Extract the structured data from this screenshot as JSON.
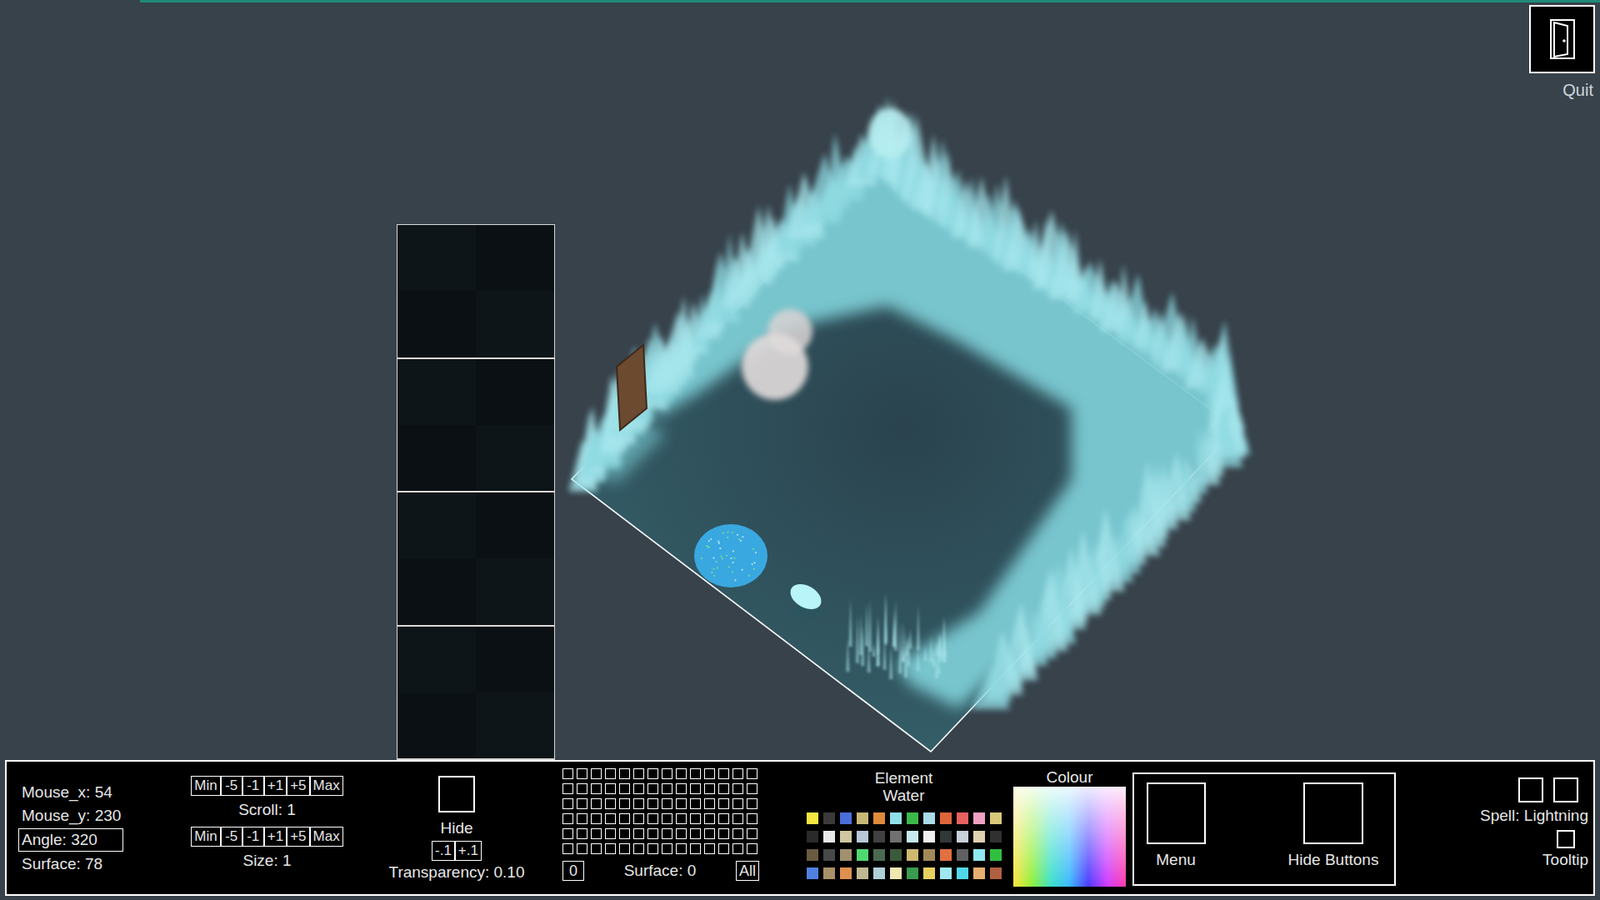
{
  "quit": {
    "label": "Quit"
  },
  "stats": [
    {
      "text": "Mouse_x: 54",
      "selected": false
    },
    {
      "text": "Mouse_y: 230",
      "selected": false
    },
    {
      "text": "Angle: 320",
      "selected": true
    },
    {
      "text": "Surface: 78",
      "selected": false
    }
  ],
  "scroll_control": {
    "buttons": [
      "Min",
      "-5",
      "-1",
      "+1",
      "+5",
      "Max"
    ],
    "label": "Scroll: 1"
  },
  "size_control": {
    "buttons": [
      "Min",
      "-5",
      "-1",
      "+1",
      "+5",
      "Max"
    ],
    "label": "Size: 1"
  },
  "hide": {
    "label": "Hide",
    "checked": false,
    "buttons": [
      "-.1",
      "+.1"
    ],
    "transparency": "Transparency: 0.10"
  },
  "surface_grid": {
    "rows": [
      [
        false,
        false,
        false,
        false,
        false,
        false,
        false,
        false,
        false,
        false,
        false,
        false,
        false,
        false
      ],
      [
        false,
        false,
        false,
        false,
        false,
        false,
        false,
        false,
        false,
        false,
        false,
        false,
        false,
        false
      ],
      [
        false,
        false,
        false,
        false,
        false,
        false,
        false,
        false,
        false,
        false,
        false,
        false,
        false,
        false
      ],
      [
        false,
        false,
        false,
        false,
        false,
        false,
        false,
        false,
        false,
        false,
        false,
        false,
        false,
        false
      ],
      [
        false,
        false,
        false,
        false,
        false,
        false,
        false,
        false,
        false,
        false,
        false,
        false,
        false,
        false
      ],
      [
        false,
        false,
        false,
        false,
        false,
        false,
        false,
        false,
        false,
        false,
        false,
        false,
        false,
        false
      ]
    ],
    "zero_button": "0",
    "label": "Surface: 0",
    "all_button": "All"
  },
  "element": {
    "title": "Element",
    "value": "Water",
    "palette": [
      "#f5e642",
      "#3a3a3a",
      "#4b6fd8",
      "#c8b878",
      "#e08a3c",
      "#8fe0e8",
      "#3cb84a",
      "#a8dce8",
      "#e0643a",
      "#e86060",
      "#f0a0c0",
      "#d8c878",
      "#2a2a2a",
      "#e8e8e8",
      "#d0c8a0",
      "#b8c8d8",
      "#404040",
      "#707070",
      "#c8e8f0",
      "#f0f0f0",
      "#303838",
      "#c8d0d8",
      "#e0d0b0",
      "#303030",
      "#6a5a40",
      "#484848",
      "#a09070",
      "#50d870",
      "#4a6a50",
      "#3a5a3a",
      "#d0b870",
      "#a08858",
      "#e07040",
      "#606060",
      "#90e8f0",
      "#30c040",
      "#5080e0",
      "#a89068",
      "#e09050",
      "#c0b890",
      "#b0d0d8",
      "#f0e8b0",
      "#3a9a50",
      "#e8d060",
      "#a0e8f0",
      "#50d8e8",
      "#e8b070",
      "#b06040"
    ]
  },
  "colour": {
    "title": "Colour"
  },
  "menu": {
    "label": "Menu"
  },
  "hide_buttons": {
    "label": "Hide Buttons"
  },
  "spell": {
    "slots": [
      {
        "checked": false
      },
      {
        "checked": false
      }
    ],
    "label": "Spell: Lightning"
  },
  "tooltip": {
    "label": "Tooltip",
    "checked": false
  }
}
